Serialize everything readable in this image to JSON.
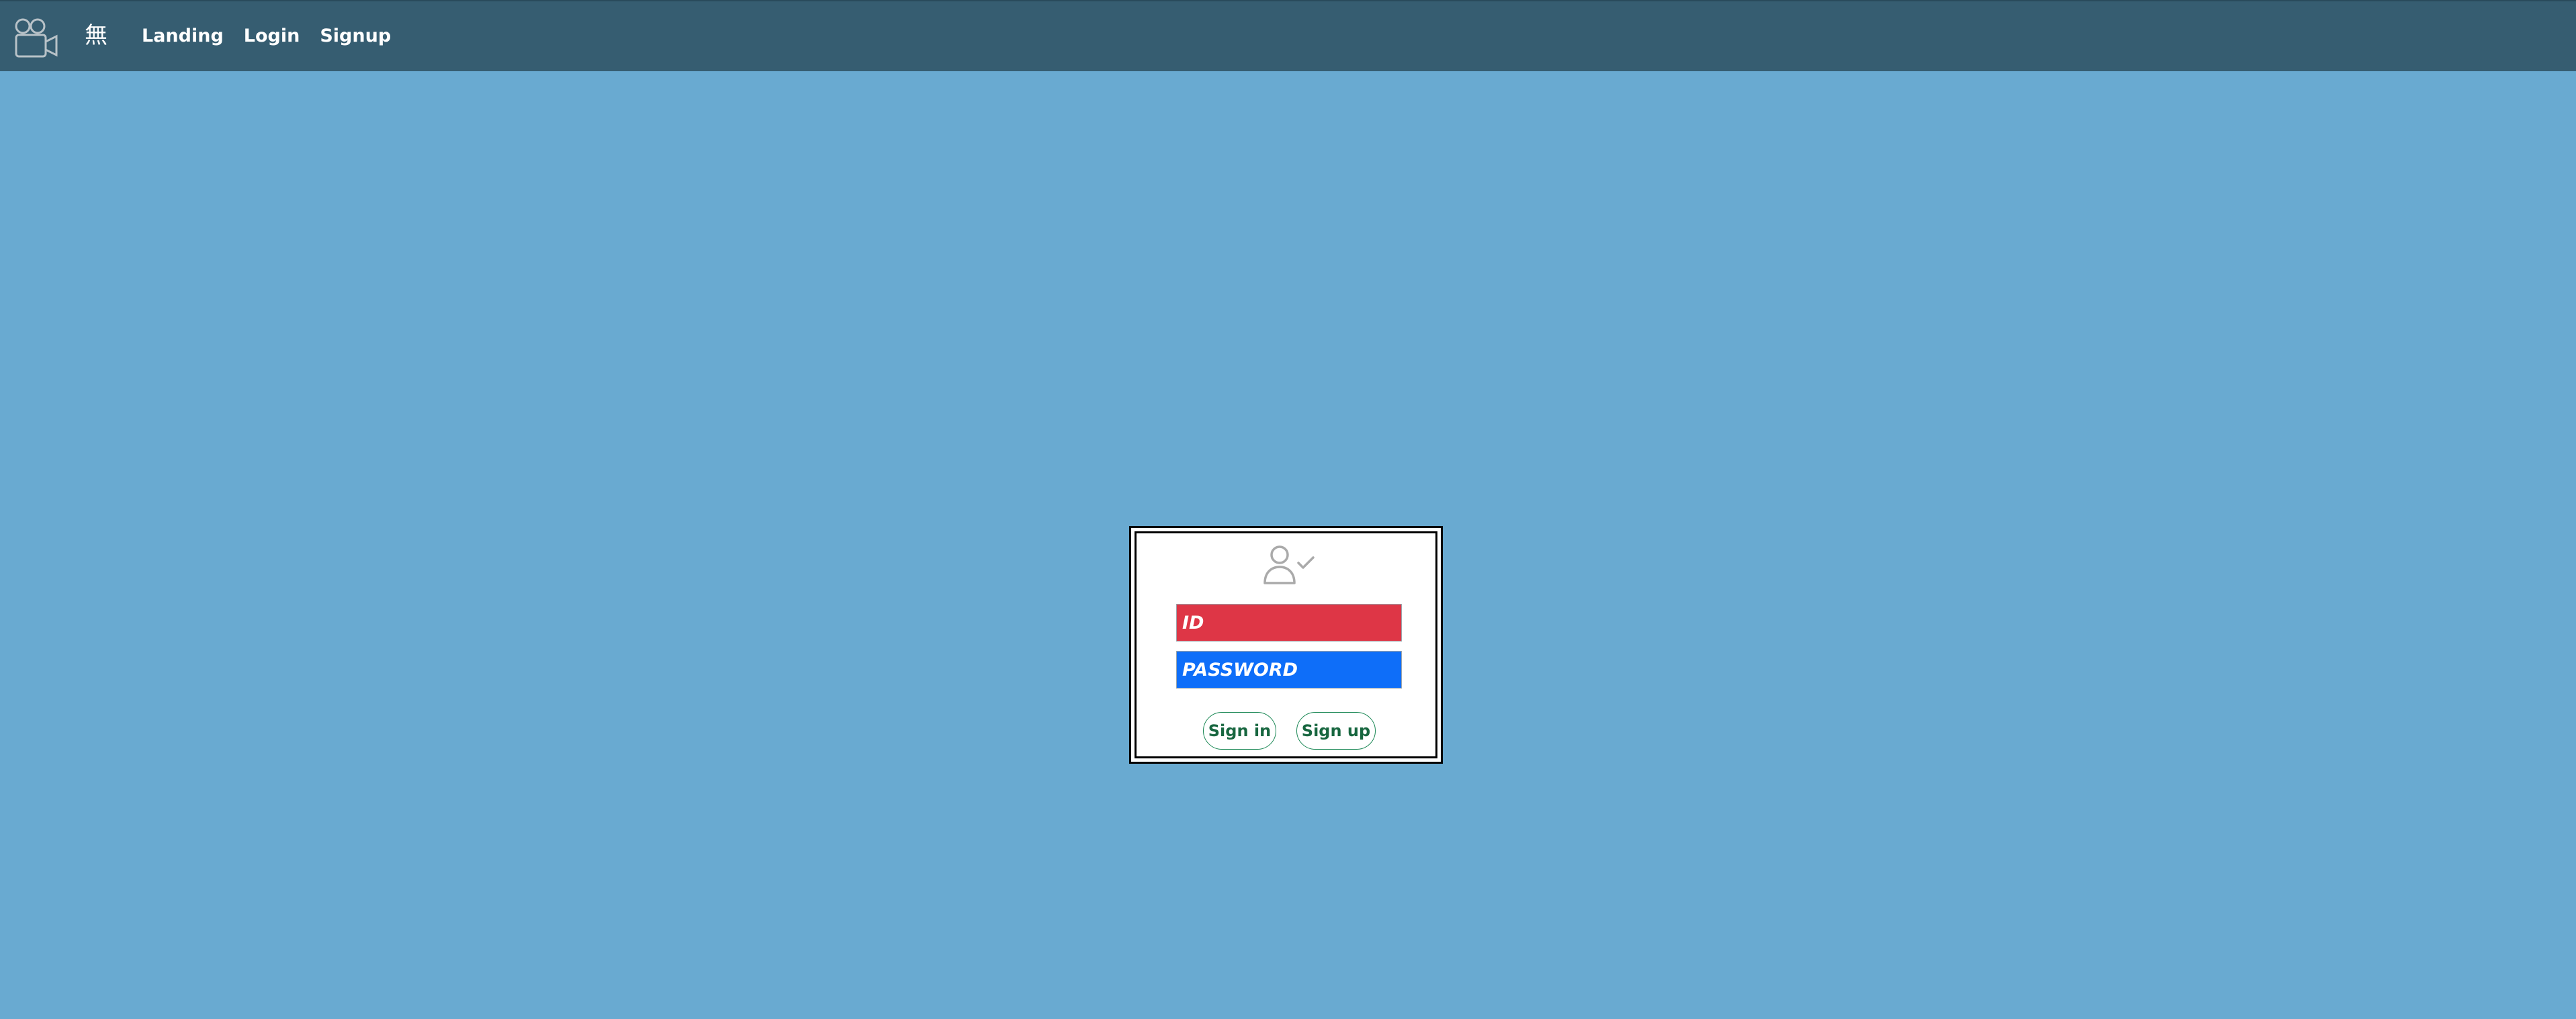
{
  "navbar": {
    "logo_icon": "video-camera-icon",
    "brand": "無",
    "links": [
      {
        "label": "Landing"
      },
      {
        "label": "Login"
      },
      {
        "label": "Signup"
      }
    ],
    "background": "#365d71"
  },
  "page": {
    "background": "#69aad1"
  },
  "login_card": {
    "icon": "user-check-icon",
    "id_field": {
      "placeholder": "ID",
      "value": "",
      "background": "#de3646"
    },
    "password_field": {
      "placeholder": "PASSWORD",
      "value": "",
      "background": "#0e6ef9"
    },
    "signin_label": "Sign in",
    "signup_label": "Sign up",
    "button_color": "#198754"
  }
}
